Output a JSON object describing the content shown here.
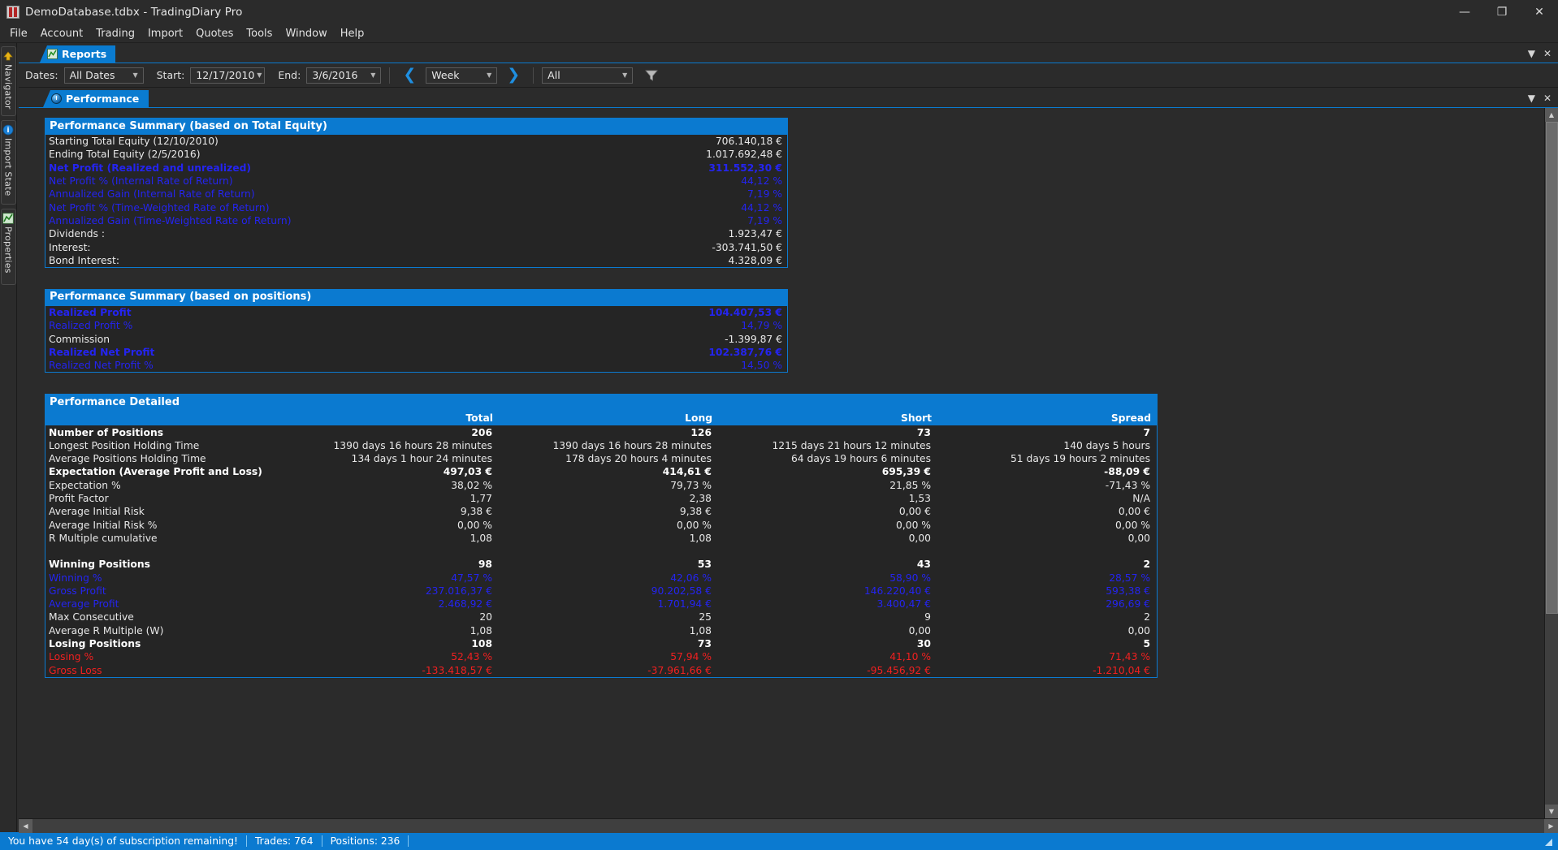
{
  "window": {
    "title": "DemoDatabase.tdbx - TradingDiary Pro",
    "minimize": "—",
    "maximize": "❐",
    "close": "✕"
  },
  "menubar": {
    "items": [
      "File",
      "Account",
      "Trading",
      "Import",
      "Quotes",
      "Tools",
      "Window",
      "Help"
    ]
  },
  "sidebar": {
    "items": [
      {
        "label": "Navigator",
        "icon": "navigator-icon"
      },
      {
        "label": "Import State",
        "icon": "import-state-icon"
      },
      {
        "label": "Properties",
        "icon": "properties-icon"
      }
    ]
  },
  "reports_panel": {
    "tab_label": "Reports",
    "minimize_glyph": "▼",
    "close_glyph": "✕"
  },
  "toolbar": {
    "dates_label": "Dates:",
    "dates_value": "All Dates",
    "start_label": "Start:",
    "start_value": "12/17/2010",
    "end_label": "End:",
    "end_value": "3/6/2016",
    "prev_glyph": "❮",
    "period_value": "Week",
    "next_glyph": "❯",
    "scope_value": "All",
    "caret_glyph": "▼"
  },
  "performance_panel": {
    "tab_label": "Performance",
    "minimize_glyph": "▼",
    "close_glyph": "✕"
  },
  "summary_equity": {
    "title": "Performance Summary (based on Total Equity)",
    "rows": [
      {
        "label": "Starting Total Equity (12/10/2010)",
        "value": "706.140,18 €",
        "style": "white"
      },
      {
        "label": "Ending Total Equity (2/5/2016)",
        "value": "1.017.692,48 €",
        "style": "white"
      },
      {
        "label": "Net Profit (Realized and unrealized)",
        "value": "311.552,30 €",
        "style": "blue-bold"
      },
      {
        "label": "Net Profit % (Internal Rate of Return)",
        "value": "44,12 %",
        "style": "blue"
      },
      {
        "label": "Annualized Gain (Internal Rate of Return)",
        "value": "7,19 %",
        "style": "blue"
      },
      {
        "label": "Net Profit % (Time-Weighted Rate of Return)",
        "value": "44,12 %",
        "style": "blue"
      },
      {
        "label": "Annualized Gain (Time-Weighted Rate of Return)",
        "value": "7,19 %",
        "style": "blue"
      },
      {
        "label": "Dividends :",
        "value": "1.923,47 €",
        "style": "white"
      },
      {
        "label": "Interest:",
        "value": "-303.741,50 €",
        "style": "white"
      },
      {
        "label": "Bond Interest:",
        "value": "4.328,09 €",
        "style": "white"
      }
    ]
  },
  "summary_positions": {
    "title": "Performance Summary (based on positions)",
    "rows": [
      {
        "label": "Realized Profit",
        "value": "104.407,53 €",
        "style": "blue-bold"
      },
      {
        "label": "Realized Profit %",
        "value": "14,79 %",
        "style": "blue"
      },
      {
        "label": "Commission",
        "value": "-1.399,87 €",
        "style": "white"
      },
      {
        "label": "Realized Net Profit",
        "value": "102.387,76 €",
        "style": "blue-bold"
      },
      {
        "label": "Realized Net Profit %",
        "value": "14,50 %",
        "style": "blue"
      }
    ]
  },
  "detailed": {
    "title": "Performance Detailed",
    "columns": [
      "Total",
      "Long",
      "Short",
      "Spread"
    ],
    "rows": [
      {
        "label": "Number of Positions",
        "style": "bold",
        "values": [
          "206",
          "126",
          "73",
          "7"
        ]
      },
      {
        "label": "Longest Position Holding Time",
        "style": "white",
        "values": [
          "1390 days 16 hours 28 minutes",
          "1390 days 16 hours 28 minutes",
          "1215 days 21 hours 12 minutes",
          "140 days 5 hours"
        ]
      },
      {
        "label": "Average Positions Holding Time",
        "style": "white",
        "values": [
          "134 days 1 hour 24 minutes",
          "178 days 20 hours 4 minutes",
          "64 days 19 hours 6 minutes",
          "51 days 19 hours 2 minutes"
        ]
      },
      {
        "label": "Expectation (Average Profit and Loss)",
        "style": "bold",
        "values": [
          "497,03 €",
          "414,61 €",
          "695,39 €",
          "-88,09 €"
        ]
      },
      {
        "label": "Expectation %",
        "style": "white",
        "values": [
          "38,02 %",
          "79,73 %",
          "21,85 %",
          "-71,43 %"
        ]
      },
      {
        "label": "Profit Factor",
        "style": "white",
        "values": [
          "1,77",
          "2,38",
          "1,53",
          "N/A"
        ]
      },
      {
        "label": "Average Initial Risk",
        "style": "white",
        "values": [
          "9,38 €",
          "9,38 €",
          "0,00 €",
          "0,00 €"
        ]
      },
      {
        "label": "Average Initial Risk %",
        "style": "white",
        "values": [
          "0,00 %",
          "0,00 %",
          "0,00 %",
          "0,00 %"
        ]
      },
      {
        "label": "R Multiple cumulative",
        "style": "white",
        "values": [
          "1,08",
          "1,08",
          "0,00",
          "0,00"
        ]
      },
      {
        "label": "",
        "style": "spacer",
        "values": [
          "",
          "",
          "",
          ""
        ]
      },
      {
        "label": "Winning Positions",
        "style": "bold",
        "values": [
          "98",
          "53",
          "43",
          "2"
        ]
      },
      {
        "label": "Winning %",
        "style": "blue",
        "values": [
          "47,57 %",
          "42,06 %",
          "58,90 %",
          "28,57 %"
        ]
      },
      {
        "label": "Gross Profit",
        "style": "blue",
        "values": [
          "237.016,37 €",
          "90.202,58 €",
          "146.220,40 €",
          "593,38 €"
        ]
      },
      {
        "label": "Average Profit",
        "style": "blue",
        "values": [
          "2.468,92 €",
          "1.701,94 €",
          "3.400,47 €",
          "296,69 €"
        ]
      },
      {
        "label": "Max Consecutive",
        "style": "white",
        "values": [
          "20",
          "25",
          "9",
          "2"
        ]
      },
      {
        "label": "Average R Multiple (W)",
        "style": "white",
        "values": [
          "1,08",
          "1,08",
          "0,00",
          "0,00"
        ]
      },
      {
        "label": "Losing Positions",
        "style": "bold",
        "values": [
          "108",
          "73",
          "30",
          "5"
        ]
      },
      {
        "label": "Losing %",
        "style": "red",
        "values": [
          "52,43 %",
          "57,94 %",
          "41,10 %",
          "71,43 %"
        ]
      },
      {
        "label": "Gross Loss",
        "style": "red",
        "values": [
          "-133.418,57 €",
          "-37.961,66 €",
          "-95.456,92 €",
          "-1.210,04 €"
        ]
      }
    ]
  },
  "statusbar": {
    "subscription": "You have 54 day(s) of subscription remaining!",
    "trades": "Trades: 764",
    "positions": "Positions: 236"
  },
  "scroll": {
    "up_glyph": "▲",
    "down_glyph": "▼",
    "left_glyph": "◀",
    "right_glyph": "▶"
  }
}
